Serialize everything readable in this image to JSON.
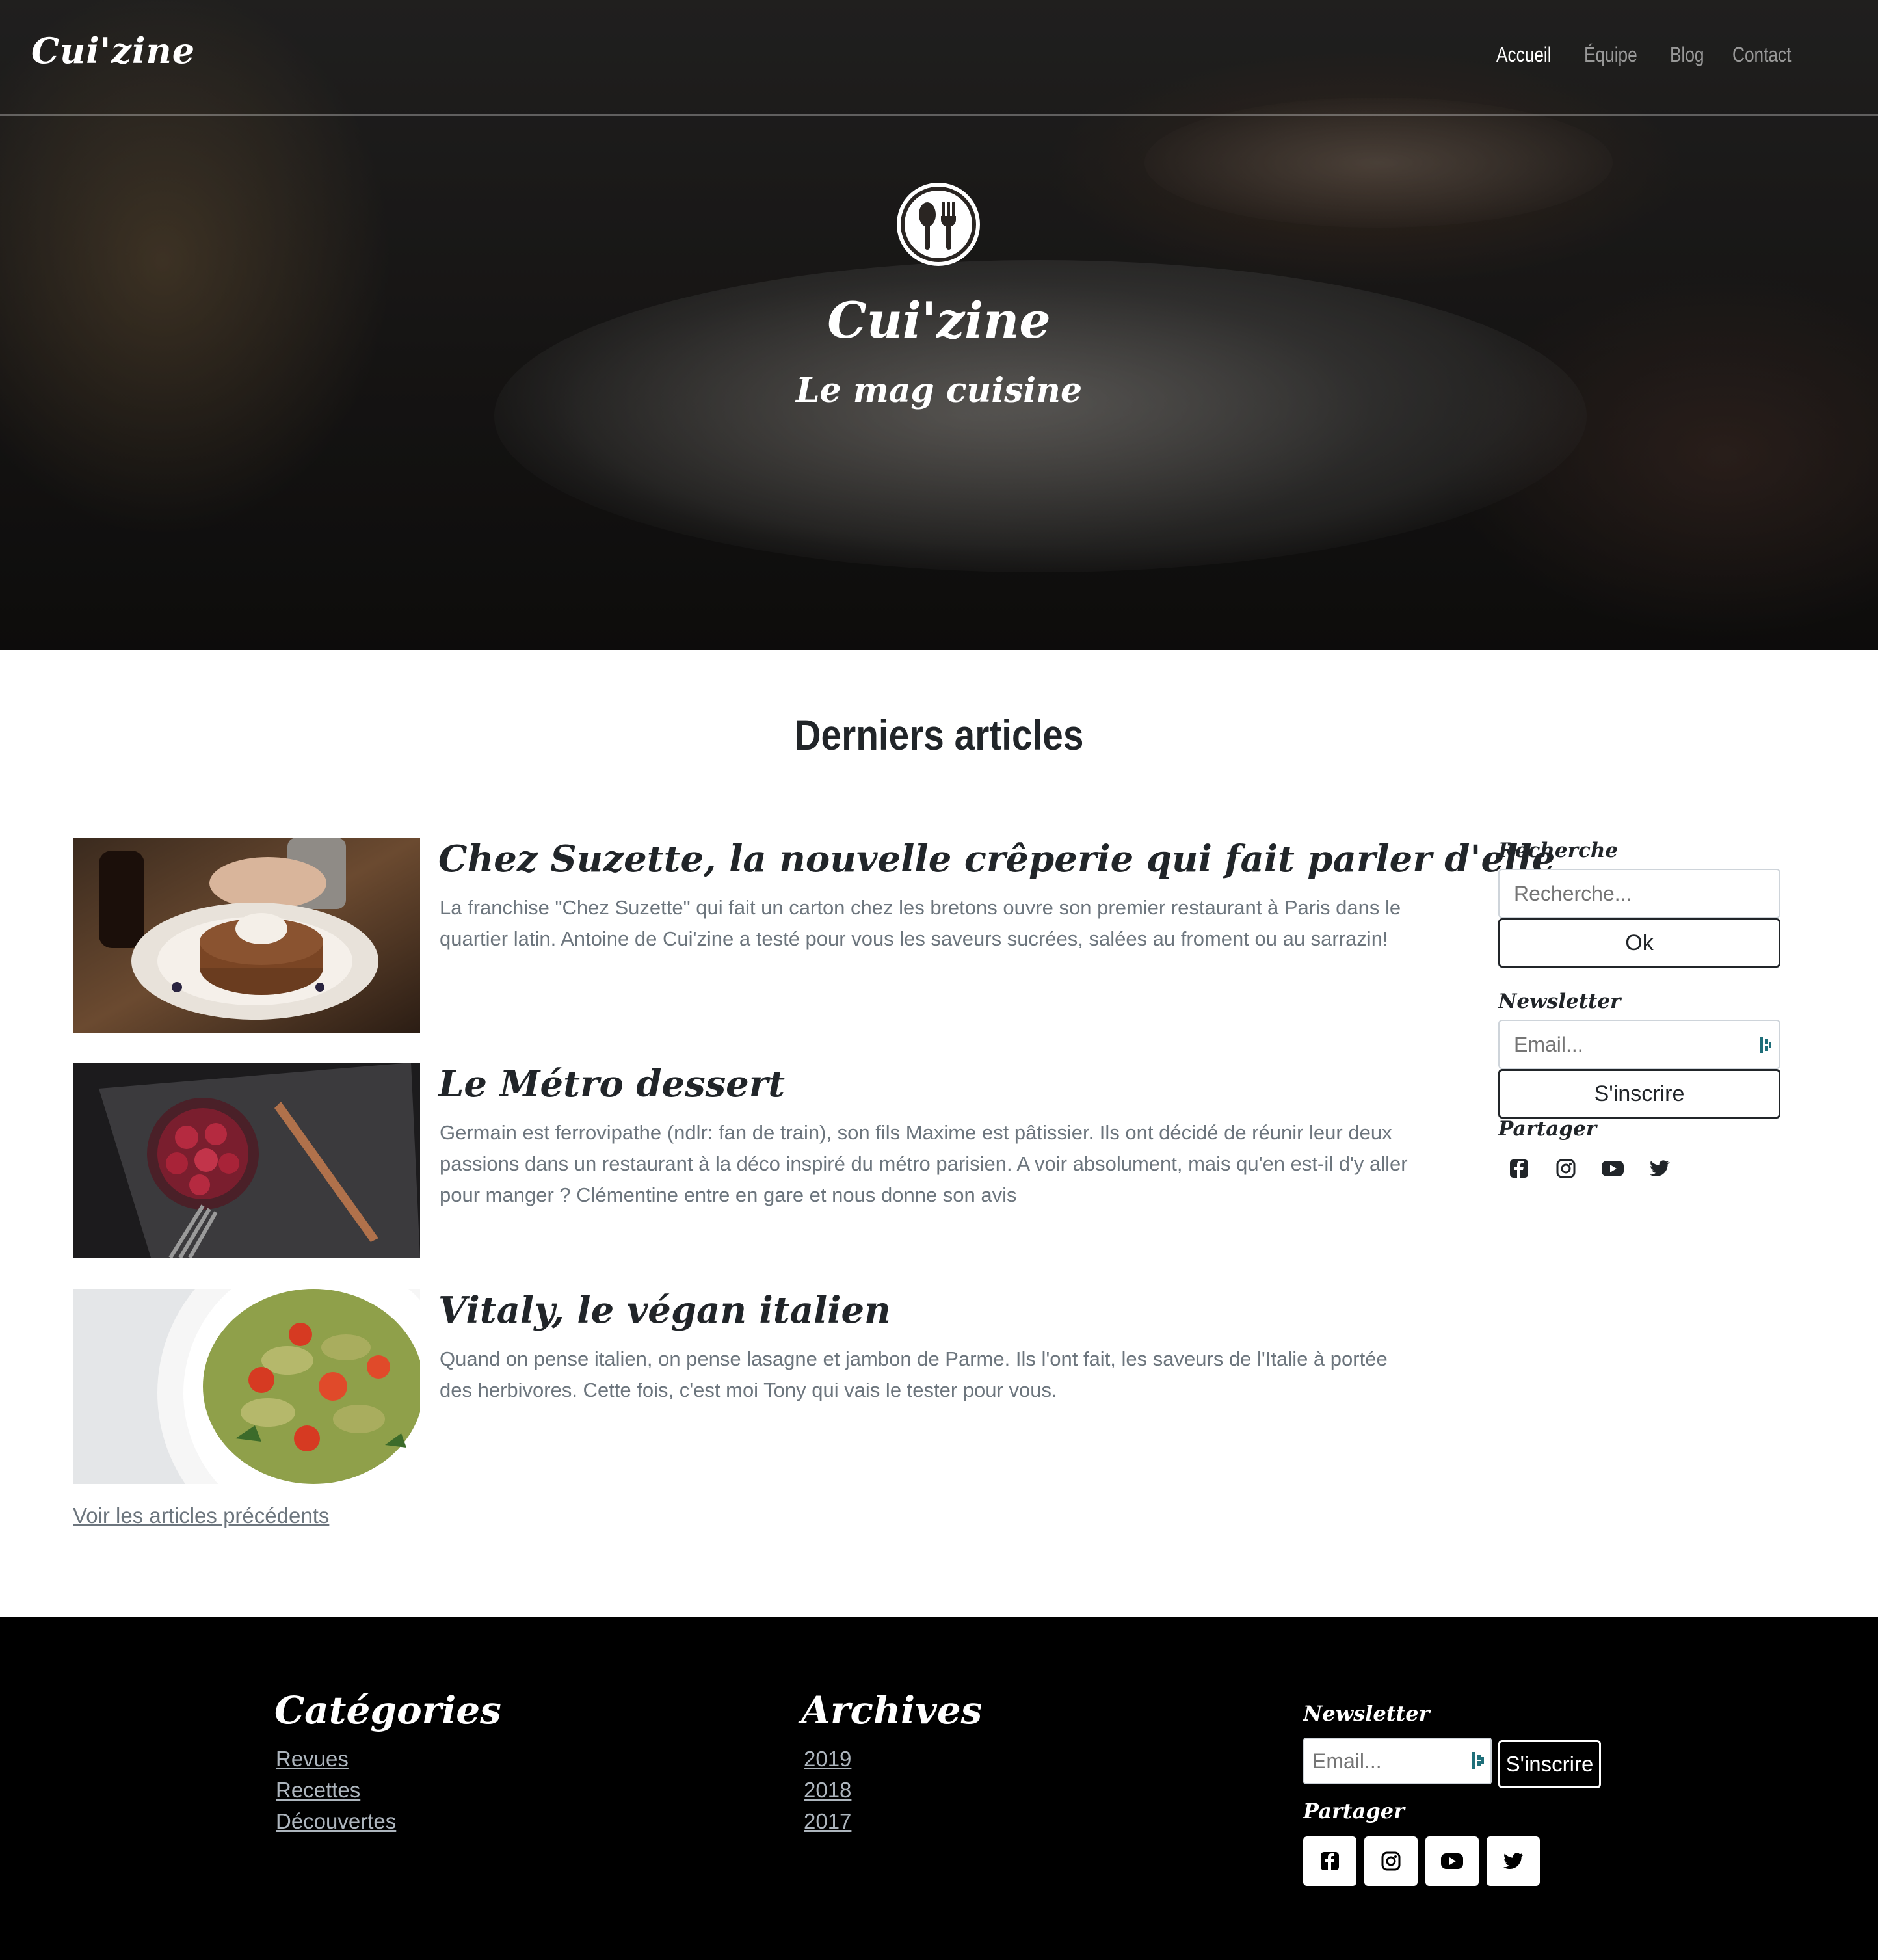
{
  "navbar": {
    "brand": "Cui'zine",
    "links": [
      "Accueil",
      "Équipe",
      "Blog",
      "Contact"
    ]
  },
  "hero": {
    "title": "Cui'zine",
    "subtitle": "Le mag cuisine",
    "logo_icon": "spoon-fork-icon"
  },
  "main": {
    "section_title": "Derniers articles",
    "articles": [
      {
        "title": "Chez Suzette, la nouvelle crêperie qui fait parler d'elle",
        "text": "La franchise \"Chez Suzette\" qui fait un carton chez les bretons ouvre son premier restaurant à Paris dans le quartier latin. Antoine de Cui'zine a testé pour vous les saveurs sucrées, salées au froment ou au sarrazin!"
      },
      {
        "title": "Le Métro dessert",
        "text": "Germain est ferrovipathe (ndlr: fan de train), son fils Maxime est pâtissier. Ils ont décidé de réunir leur deux passions dans un restaurant à la déco inspiré du métro parisien. A voir absolument, mais qu'en est-il d'y aller pour manger ? Clémentine entre en gare et nous donne son avis"
      },
      {
        "title": "Vitaly, le végan italien",
        "text": "Quand on pense italien, on pense lasagne et jambon de Parme. Ils l'ont fait, les saveurs de l'Italie à portée des herbivores. Cette fois, c'est moi Tony qui vais le tester pour vous."
      }
    ],
    "previous_link": "Voir les articles précédents"
  },
  "sidebar": {
    "search_label": "Recherche",
    "search_placeholder": "Recherche...",
    "search_button": "Ok",
    "newsletter_label": "Newsletter",
    "email_placeholder": "Email...",
    "subscribe_button": "S'inscrire",
    "share_label": "Partager",
    "social_icons": [
      "facebook-icon",
      "instagram-icon",
      "youtube-icon",
      "twitter-icon"
    ]
  },
  "footer": {
    "categories_title": "Catégories",
    "categories": [
      "Revues",
      "Recettes",
      "Découvertes"
    ],
    "archives_title": "Archives",
    "archives": [
      "2019",
      "2018",
      "2017"
    ],
    "newsletter_label": "Newsletter",
    "email_placeholder": "Email...",
    "subscribe_button": "S'inscrire",
    "share_label": "Partager"
  }
}
